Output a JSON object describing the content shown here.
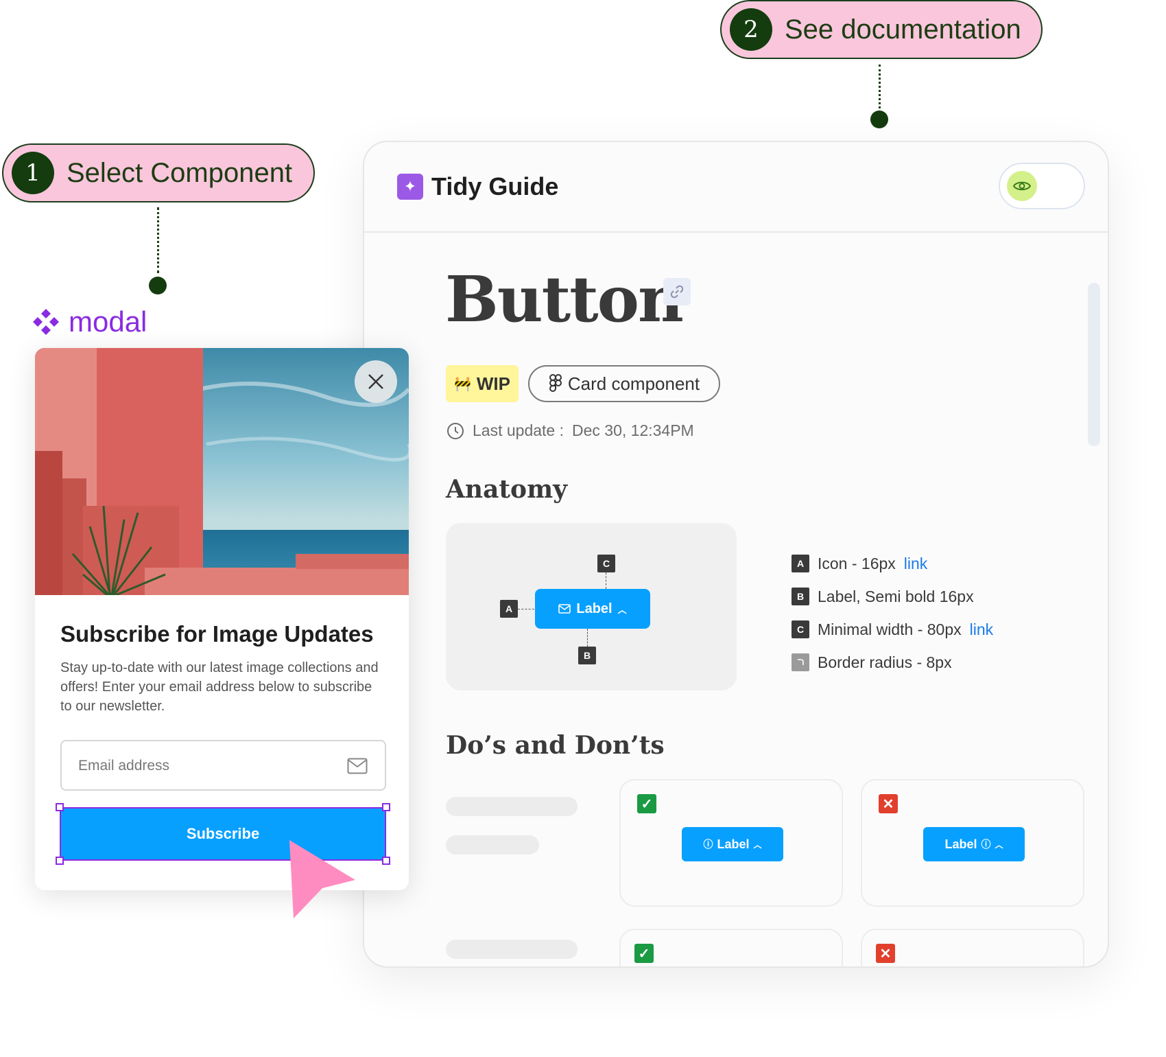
{
  "steps": [
    {
      "number": "1",
      "label": "Select Component"
    },
    {
      "number": "2",
      "label": "See documentation"
    }
  ],
  "modal": {
    "tag_label": "modal",
    "title": "Subscribe for Image Updates",
    "description": "Stay up-to-date with our latest image collections and offers! Enter your email address below to subscribe to our newsletter.",
    "email_placeholder": "Email address",
    "subscribe_label": "Subscribe"
  },
  "guide": {
    "brand": "Tidy Guide",
    "component_title": "Button",
    "status_badge": "WIP",
    "figma_badge": "Card component",
    "last_update_label": "Last update :",
    "last_update_value": "Dec 30, 12:34PM",
    "anatomy_heading": "Anatomy",
    "anatomy_button_label": "Label",
    "anatomy_markers": {
      "a": "A",
      "b": "B",
      "c": "C"
    },
    "specs": [
      {
        "marker": "A",
        "text": "Icon - 16px",
        "link": "link"
      },
      {
        "marker": "B",
        "text": "Label, Semi bold 16px",
        "link": ""
      },
      {
        "marker": "C",
        "text": "Minimal width - 80px",
        "link": "link"
      },
      {
        "marker": "",
        "text": "Border radius - 8px",
        "link": ""
      }
    ],
    "dos_heading": "Do’s  and Don’ts",
    "example_button_label": "Label"
  },
  "colors": {
    "pill_bg": "#f9c6dc",
    "pill_number_bg": "#143c0e",
    "accent_blue": "#08a0ff",
    "selection_purple": "#8a2be2",
    "cursor_pink": "#ff8cc0",
    "wip_yellow": "#fff59a",
    "do_green": "#1a9a43",
    "dont_red": "#e1402d"
  }
}
